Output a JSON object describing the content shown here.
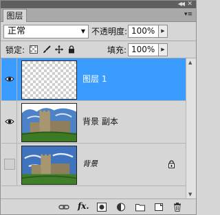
{
  "panel": {
    "tab_label": "图层",
    "menu_icon": "panel-menu-icon"
  },
  "blend": {
    "mode": "正常",
    "opacity_label": "不透明度:",
    "opacity_value": "100%"
  },
  "locks": {
    "label": "锁定:",
    "fill_label": "填充:",
    "fill_value": "100%",
    "icons": [
      "lock-transparent-icon",
      "lock-image-brush-icon",
      "lock-position-move-icon",
      "lock-all-padlock-icon"
    ]
  },
  "layers": [
    {
      "name": "图层 1",
      "visible": true,
      "selected": true,
      "thumbnail": "transparent",
      "locked": false
    },
    {
      "name": "背景 副本",
      "visible": true,
      "selected": false,
      "thumbnail": "castle",
      "locked": false
    },
    {
      "name": "背景",
      "visible": false,
      "selected": false,
      "thumbnail": "castle",
      "locked": true
    }
  ],
  "toolbar": {
    "icons": [
      "link-layers-icon",
      "fx-layer-style-icon",
      "add-mask-icon",
      "adjustment-layer-icon",
      "new-group-folder-icon",
      "new-layer-icon",
      "trash-icon"
    ],
    "fx_label": "fx."
  },
  "colors": {
    "selected_row": "#3a9cff",
    "panel_bg": "#d6d6d6"
  }
}
